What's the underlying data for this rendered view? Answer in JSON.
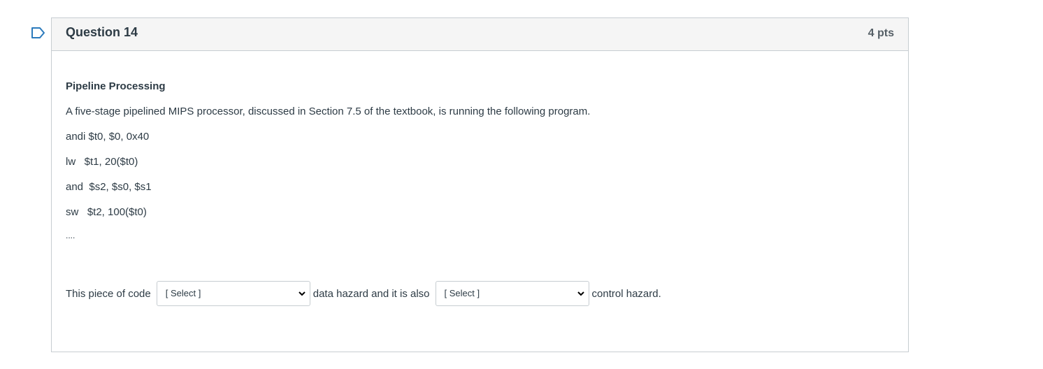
{
  "question": {
    "title": "Question 14",
    "points": "4 pts"
  },
  "body": {
    "heading": "Pipeline Processing",
    "description": "A five-stage pipelined MIPS processor, discussed in Section 7.5 of the textbook, is running the following program.",
    "code_lines": [
      "andi $t0, $0, 0x40",
      "lw   $t1, 20($t0)",
      "and  $s2, $s0, $s1",
      "sw   $t2, 100($t0)",
      "...."
    ]
  },
  "answer": {
    "prefix": "This piece of code",
    "select1": "[ Select ]",
    "middle": "data hazard and it is also",
    "select2": "[ Select ]",
    "suffix": "control hazard."
  },
  "icons": {
    "flag": "bookmark-flag-icon",
    "dropdown": "chevron-down-icon"
  },
  "colors": {
    "flag_stroke": "#2b7abc",
    "header_bg": "#f5f5f5",
    "border": "#c7cdd1",
    "text": "#2d3b45"
  }
}
